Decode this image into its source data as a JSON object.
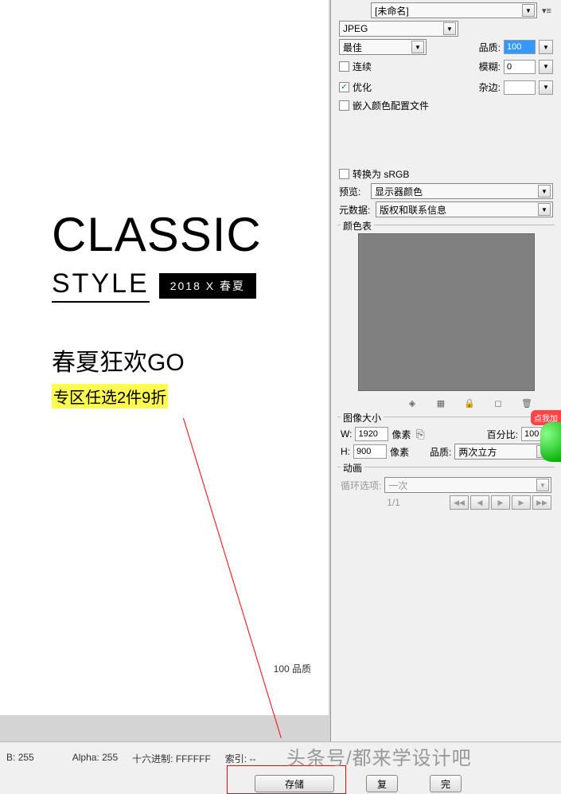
{
  "canvas": {
    "title": "CLASSIC",
    "subtitle": "STYLE",
    "badge": "2018 X 春夏",
    "promo_title": "春夏狂欢GO",
    "promo_sub": "专区任选2件9折",
    "quality_label": "100 品质"
  },
  "export": {
    "preset_value": "[未命名]",
    "format": "JPEG",
    "format_quality": "最佳",
    "quality_label": "品质:",
    "quality_value": "100",
    "progressive_label": "连续",
    "blur_label": "模糊:",
    "blur_value": "0",
    "optimize_label": "优化",
    "matte_label": "杂边:",
    "embed_profile_label": "嵌入颜色配置文件"
  },
  "convert": {
    "srgb_label": "转换为 sRGB",
    "preview_label": "预览:",
    "preview_value": "显示器颜色",
    "metadata_label": "元数据:",
    "metadata_value": "版权和联系信息"
  },
  "color_table": {
    "title": "颜色表"
  },
  "image_size": {
    "title": "图像大小",
    "w_label": "W:",
    "w_value": "1920",
    "h_label": "H:",
    "h_value": "900",
    "unit": "像素",
    "percent_label": "百分比:",
    "percent_value": "100",
    "quality_label": "品质:",
    "quality_value": "两次立方"
  },
  "animation": {
    "title": "动画",
    "loop_label": "循环选项:",
    "loop_value": "一次",
    "page": "1/1"
  },
  "footer": {
    "b_label": "B:",
    "b_value": "255",
    "alpha_label": "Alpha:",
    "alpha_value": "255",
    "hex_label": "十六进制:",
    "hex_value": "FFFFFF",
    "index_label": "索引:",
    "index_value": "--",
    "save_btn": "存储",
    "copy_btn": "复",
    "done_btn": "完"
  },
  "watermark": "头条号/都来学设计吧",
  "float_badge": "点我加"
}
